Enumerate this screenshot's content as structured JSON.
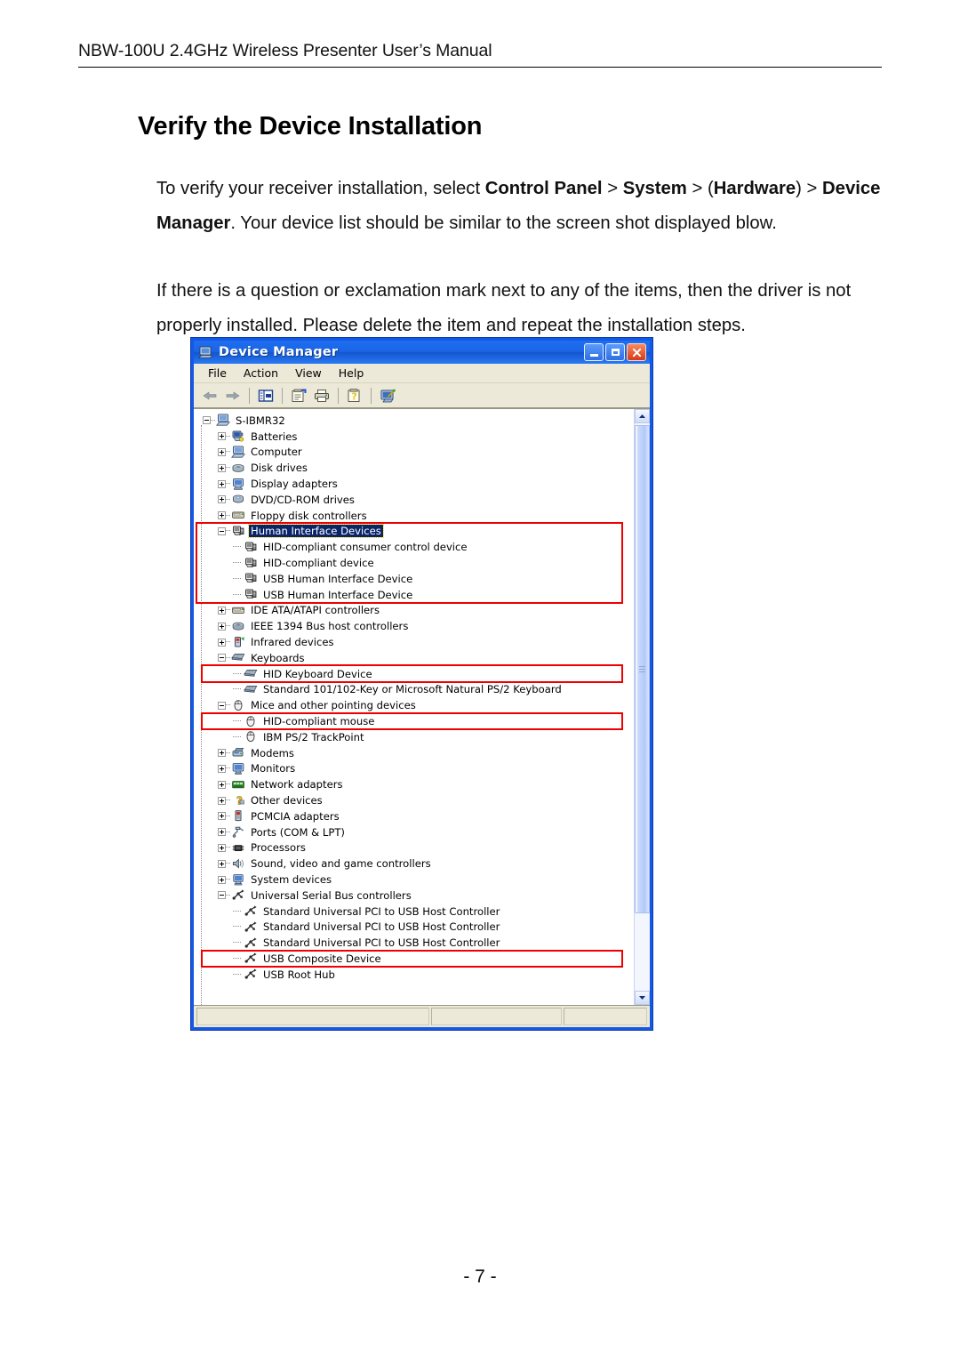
{
  "document": {
    "header_text": "NBW-100U 2.4GHz Wireless Presenter User’s Manual",
    "section_title": "Verify the Device Installation",
    "paragraph1": {
      "part1": "To verify your receiver installation, select ",
      "b1": "Control Panel",
      "sep1": " > ",
      "b2": "System",
      "sep2": " > (",
      "b3": "Hardware",
      "sep3": ") > ",
      "b4": "Device Manager",
      "part2": ". Your device list should be similar to the screen shot displayed blow."
    },
    "paragraph2": "If there is a question or exclamation mark next to any of the items, then the driver is not properly installed. Please delete the item and repeat the installation steps.",
    "page_number": "- 7 -"
  },
  "device_manager": {
    "title": "Device Manager",
    "title_icon": "computer-icon",
    "window_buttons": {
      "minimize": "minimize-button",
      "maximize": "maximize-button",
      "close": "close-button"
    },
    "menu": [
      "File",
      "Action",
      "View",
      "Help"
    ],
    "toolbar": [
      {
        "name": "back-button",
        "icon": "left-arrow-icon"
      },
      {
        "name": "forward-button",
        "icon": "right-arrow-icon"
      },
      {
        "name": "show-hide-console-tree-button",
        "icon": "console-tree-icon"
      },
      {
        "name": "properties-button",
        "icon": "properties-icon"
      },
      {
        "name": "print-button",
        "icon": "printer-icon"
      },
      {
        "name": "help-button",
        "icon": "help-icon"
      },
      {
        "name": "scan-for-hardware-changes-button",
        "icon": "scan-hardware-icon"
      }
    ],
    "tree": [
      {
        "label": "S-IBMR32",
        "level": 0,
        "state": "expanded",
        "icon": "computer-icon"
      },
      {
        "label": "Batteries",
        "level": 1,
        "state": "collapsed",
        "icon": "battery-icon"
      },
      {
        "label": "Computer",
        "level": 1,
        "state": "collapsed",
        "icon": "computer-icon"
      },
      {
        "label": "Disk drives",
        "level": 1,
        "state": "collapsed",
        "icon": "disk-drive-icon"
      },
      {
        "label": "Display adapters",
        "level": 1,
        "state": "collapsed",
        "icon": "display-adapter-icon"
      },
      {
        "label": "DVD/CD-ROM drives",
        "level": 1,
        "state": "collapsed",
        "icon": "dvd-drive-icon"
      },
      {
        "label": "Floppy disk controllers",
        "level": 1,
        "state": "collapsed",
        "icon": "floppy-controller-icon"
      },
      {
        "label": "Human Interface Devices",
        "level": 1,
        "state": "expanded",
        "icon": "hid-icon",
        "selected": true
      },
      {
        "label": "HID-compliant consumer control device",
        "level": 2,
        "state": "leaf",
        "icon": "hid-icon"
      },
      {
        "label": "HID-compliant device",
        "level": 2,
        "state": "leaf",
        "icon": "hid-icon"
      },
      {
        "label": "USB Human Interface Device",
        "level": 2,
        "state": "leaf",
        "icon": "hid-icon"
      },
      {
        "label": "USB Human Interface Device",
        "level": 2,
        "state": "leaf",
        "icon": "hid-icon"
      },
      {
        "label": "IDE ATA/ATAPI controllers",
        "level": 1,
        "state": "collapsed",
        "icon": "ide-controller-icon"
      },
      {
        "label": "IEEE 1394 Bus host controllers",
        "level": 1,
        "state": "collapsed",
        "icon": "ieee1394-icon"
      },
      {
        "label": "Infrared devices",
        "level": 1,
        "state": "collapsed",
        "icon": "infrared-icon"
      },
      {
        "label": "Keyboards",
        "level": 1,
        "state": "expanded",
        "icon": "keyboard-icon"
      },
      {
        "label": "HID Keyboard Device",
        "level": 2,
        "state": "leaf",
        "icon": "keyboard-icon"
      },
      {
        "label": "Standard 101/102-Key or Microsoft Natural PS/2 Keyboard",
        "level": 2,
        "state": "leaf",
        "icon": "keyboard-icon"
      },
      {
        "label": "Mice and other pointing devices",
        "level": 1,
        "state": "expanded",
        "icon": "mouse-icon"
      },
      {
        "label": "HID-compliant mouse",
        "level": 2,
        "state": "leaf",
        "icon": "mouse-icon"
      },
      {
        "label": "IBM PS/2 TrackPoint",
        "level": 2,
        "state": "leaf",
        "icon": "mouse-icon"
      },
      {
        "label": "Modems",
        "level": 1,
        "state": "collapsed",
        "icon": "modem-icon"
      },
      {
        "label": "Monitors",
        "level": 1,
        "state": "collapsed",
        "icon": "monitor-icon"
      },
      {
        "label": "Network adapters",
        "level": 1,
        "state": "collapsed",
        "icon": "network-adapter-icon"
      },
      {
        "label": "Other devices",
        "level": 1,
        "state": "collapsed",
        "icon": "other-devices-icon"
      },
      {
        "label": "PCMCIA adapters",
        "level": 1,
        "state": "collapsed",
        "icon": "pcmcia-icon"
      },
      {
        "label": "Ports (COM & LPT)",
        "level": 1,
        "state": "collapsed",
        "icon": "port-icon"
      },
      {
        "label": "Processors",
        "level": 1,
        "state": "collapsed",
        "icon": "processor-icon"
      },
      {
        "label": "Sound, video and game controllers",
        "level": 1,
        "state": "collapsed",
        "icon": "sound-icon"
      },
      {
        "label": "System devices",
        "level": 1,
        "state": "collapsed",
        "icon": "system-device-icon"
      },
      {
        "label": "Universal Serial Bus controllers",
        "level": 1,
        "state": "expanded",
        "icon": "usb-icon"
      },
      {
        "label": "Standard Universal PCI to USB Host Controller",
        "level": 2,
        "state": "leaf",
        "icon": "usb-icon"
      },
      {
        "label": "Standard Universal PCI to USB Host Controller",
        "level": 2,
        "state": "leaf",
        "icon": "usb-icon"
      },
      {
        "label": "Standard Universal PCI to USB Host Controller",
        "level": 2,
        "state": "leaf",
        "icon": "usb-icon"
      },
      {
        "label": "USB Composite Device",
        "level": 2,
        "state": "leaf",
        "icon": "usb-icon"
      },
      {
        "label": "USB Root Hub",
        "level": 2,
        "state": "leaf",
        "icon": "usb-icon"
      }
    ],
    "highlights": [
      {
        "name": "highlight-human-interface-devices",
        "start_index": 7,
        "end_index": 11
      },
      {
        "name": "highlight-hid-keyboard-device",
        "start_index": 16,
        "end_index": 16
      },
      {
        "name": "highlight-hid-compliant-mouse",
        "start_index": 19,
        "end_index": 19
      },
      {
        "name": "highlight-usb-composite-device",
        "start_index": 34,
        "end_index": 34
      }
    ],
    "highlight_color": "#ee0000",
    "selection_color": "#0a246a",
    "titlebar_color": "#1b63e4",
    "status_panels": [
      "",
      "",
      ""
    ],
    "scrollbar": {
      "up": "scroll-up-arrow",
      "down": "scroll-down-arrow"
    }
  }
}
